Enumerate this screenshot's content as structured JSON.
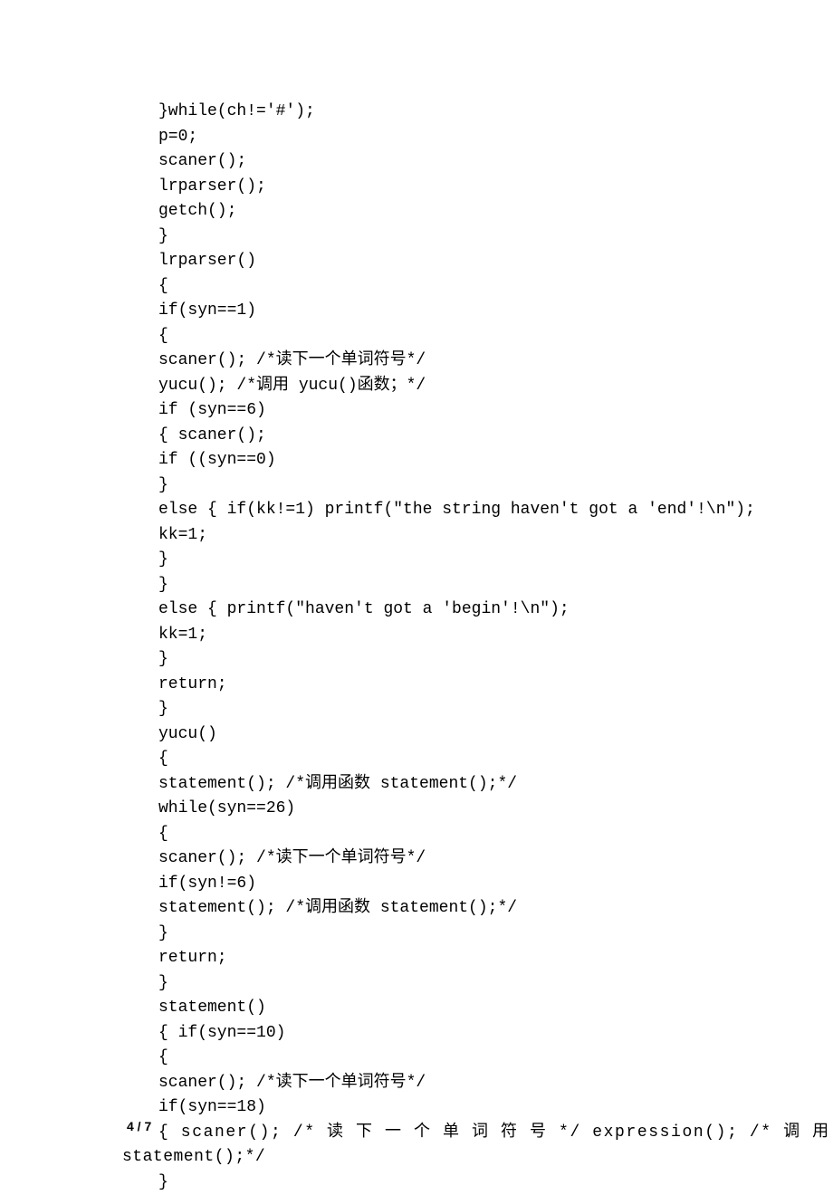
{
  "lines": [
    "}while(ch!='#');",
    "p=0;",
    "scaner();",
    "lrparser();",
    "getch();",
    "}",
    "lrparser()",
    "{",
    "if(syn==1)",
    "{",
    "scaner(); /*读下一个单词符号*/",
    "yucu(); /*调用 yucu()函数；*/",
    "if (syn==6)",
    "{ scaner();",
    "if ((syn==0)",
    "}",
    "else { if(kk!=1) printf(\"the string haven't got a 'end'!\\n\");",
    "kk=1;",
    "}",
    "}",
    "else { printf(\"haven't got a 'begin'!\\n\");",
    "kk=1;",
    "}",
    "return;",
    "}",
    "yucu()",
    "{",
    "statement(); /*调用函数 statement();*/",
    "while(syn==26)",
    "{",
    "scaner(); /*读下一个单词符号*/",
    "if(syn!=6)",
    "statement(); /*调用函数 statement();*/",
    "}",
    "return;",
    "}",
    "statement()",
    "{ if(syn==10)",
    "{",
    "scaner(); /*读下一个单词符号*/",
    "if(syn==18)"
  ],
  "wide_line": "{ scaner(); /* 读 下 一 个 单 词 符 号 */ expression(); /* 调 用 函 数",
  "wrap_line": "statement();*/",
  "last_line": "}",
  "page_number": "4 / 7"
}
